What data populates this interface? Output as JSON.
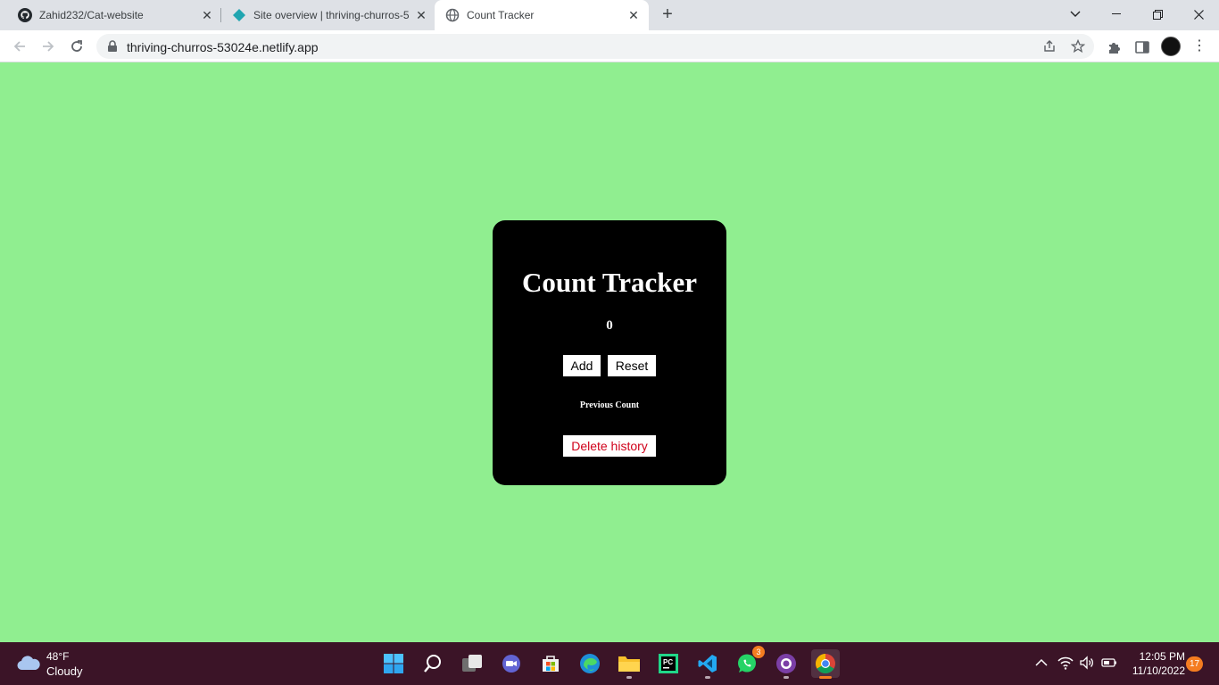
{
  "browser": {
    "tabs": [
      {
        "title": "Zahid232/Cat-website",
        "icon": "github-icon"
      },
      {
        "title": "Site overview | thriving-churros-5",
        "icon": "netlify-icon"
      },
      {
        "title": "Count Tracker",
        "icon": "globe-icon",
        "active": true
      }
    ],
    "url": "thriving-churros-53024e.netlify.app"
  },
  "page": {
    "background": "#90ee90",
    "title": "Count Tracker",
    "count": "0",
    "add_label": "Add",
    "reset_label": "Reset",
    "previous_label": "Previous Count",
    "delete_label": "Delete history"
  },
  "taskbar": {
    "weather_temp": "48°F",
    "weather_cond": "Cloudy",
    "whatsapp_badge": "3",
    "time": "12:05 PM",
    "date": "11/10/2022",
    "notifications": "17"
  }
}
